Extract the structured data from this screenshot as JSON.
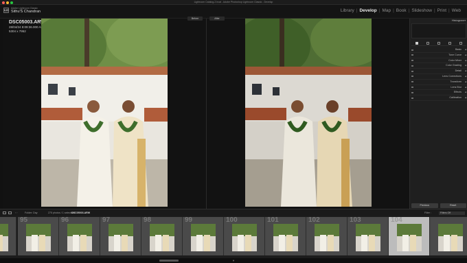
{
  "window": {
    "title": "Lightroom Catalog-2.lrcat - Adobe Photoshop Lightroom Classic - Develop"
  },
  "identity": {
    "logo": "LrC",
    "subtitle": "Adobe Lightroom Classic",
    "name": "Sithu'S Chandran"
  },
  "modules": [
    "Library",
    "Develop",
    "Map",
    "Book",
    "Slideshow",
    "Print",
    "Web"
  ],
  "active_module": "Develop",
  "photo_info": {
    "filename": "DSC05003.ARW",
    "datetime": "28/04/24 8:09:36.000 AM",
    "dimensions": "5304 x 7952"
  },
  "compare": {
    "before_label": "Before",
    "after_label": "After"
  },
  "right_panel": {
    "histogram_label": "Histogram",
    "sections": [
      "Basic",
      "Tone Curve",
      "Color Mixer",
      "Color Grading",
      "Detail",
      "Lens Corrections",
      "Transform",
      "Lens Blur",
      "Effects",
      "Calibration"
    ],
    "buttons": {
      "previous": "Previous",
      "reset": "Reset"
    }
  },
  "filmstrip": {
    "folder": "Folder: Day",
    "count_text": "275 photos / 1 selected /",
    "selected_file": "DSC05003.ARW",
    "filter_label": "Filter :",
    "filter_value": "Filters Off",
    "numbers": [
      "",
      "95",
      "96",
      "97",
      "98",
      "99",
      "100",
      "101",
      "102",
      "103",
      "104",
      ""
    ]
  },
  "colors": {
    "accent": "#e8e8e8",
    "panel_bg": "#1f1f1f",
    "canvas": "#121212",
    "selected_cell": "#bcbcbc"
  },
  "icons": [
    "lrc-logo-icon",
    "grid-view-icon",
    "loupe-view-icon",
    "histogram-tool-icon",
    "crop-icon",
    "heal-icon",
    "redeye-icon",
    "masking-icon",
    "chevron-left-icon",
    "triangle-down-icon"
  ]
}
